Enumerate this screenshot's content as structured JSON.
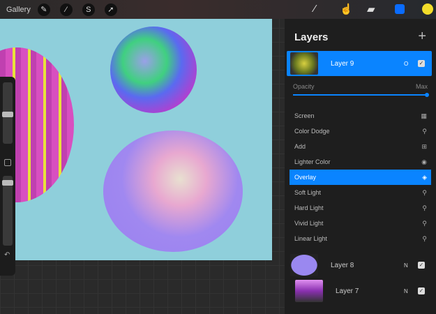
{
  "topbar": {
    "gallery": "Gallery",
    "tools": [
      "wrench-icon",
      "magic-wand-icon",
      "selection-icon",
      "transform-icon"
    ],
    "right_tools": [
      "brush-icon",
      "smudge-icon",
      "eraser-icon",
      "layers-icon"
    ],
    "color": "#f2dd2a"
  },
  "layers": {
    "title": "Layers",
    "add": "+",
    "active": {
      "name": "Layer 9",
      "mode": "O"
    },
    "opacity_label": "Opacity",
    "opacity_value": "Max",
    "opacity": 1.0,
    "blend_modes": [
      {
        "label": "Screen",
        "icon": "▦"
      },
      {
        "label": "Color Dodge",
        "icon": "⚲"
      },
      {
        "label": "Add",
        "icon": "⊞"
      },
      {
        "label": "Lighter Color",
        "icon": "◉"
      },
      {
        "label": "Overlay",
        "icon": "◈",
        "selected": true
      },
      {
        "label": "Soft Light",
        "icon": "⚲"
      },
      {
        "label": "Hard Light",
        "icon": "⚲"
      },
      {
        "label": "Vivid Light",
        "icon": "⚲"
      },
      {
        "label": "Linear Light",
        "icon": "⚲"
      }
    ],
    "others": [
      {
        "name": "Layer 8",
        "mode": "N"
      },
      {
        "name": "Layer 7",
        "mode": "N"
      }
    ]
  },
  "accent": "#0a84ff"
}
